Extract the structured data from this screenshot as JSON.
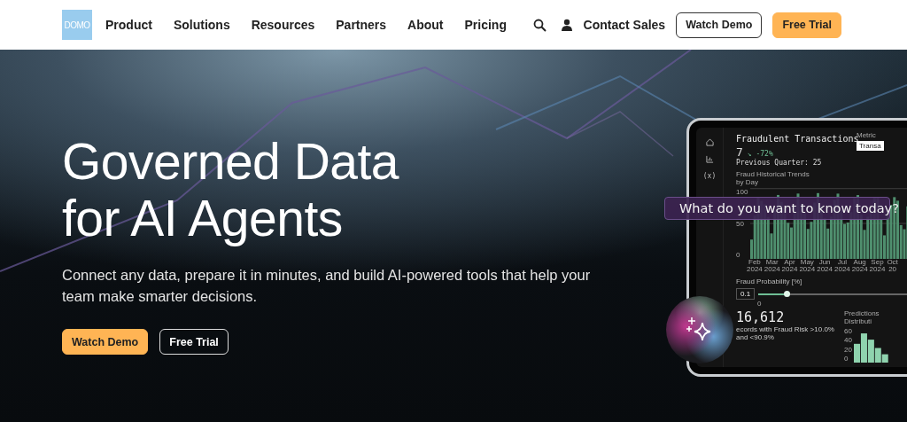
{
  "nav": {
    "logo": "DOMO",
    "items": [
      "Product",
      "Solutions",
      "Resources",
      "Partners",
      "About",
      "Pricing"
    ],
    "contact": "Contact Sales",
    "buttons": [
      {
        "label": "Watch Demo",
        "kind": "outline"
      },
      {
        "label": "Free Trial",
        "kind": "filled"
      }
    ]
  },
  "hero": {
    "title_lines": [
      "Governed Data",
      "for AI Agents"
    ],
    "subtitle": "Connect any data, prepare it in minutes, and build AI-powered tools that help your team make smarter decisions.",
    "buttons": [
      {
        "label": "Watch Demo",
        "kind": "filled"
      },
      {
        "label": "Free Trial",
        "kind": "outline"
      }
    ]
  },
  "dashboard": {
    "variable_icon": "(x)",
    "title": "Fraudulent Transactions",
    "value": "7",
    "change": "↘ -72%",
    "previous": "Previous Quarter: 25",
    "chart_title": "Fraud Historical Trends",
    "chart_subtitle": "by Day",
    "metric_label": "Metric",
    "metric_value": "Transa",
    "y_ticks": [
      "100",
      "50",
      "0"
    ],
    "months": [
      "Feb 2024",
      "Mar 2024",
      "Apr 2024",
      "May 2024",
      "Jun 2024",
      "Jul 2024",
      "Aug 2024",
      "Sep 2024",
      "Oct 20"
    ],
    "slider_label": "Fraud Probability [%]",
    "slider_value": "0.1",
    "slider_min": "0",
    "level": 0.16,
    "records_count": "16,612",
    "records_caption": "ecords with Fraud Risk >10.0% and <90.9%",
    "distribution_title": "Predictions Distributi",
    "dist_ticks": [
      "60",
      "40",
      "20",
      "0"
    ]
  },
  "prompt": "What do you want to know today?"
}
